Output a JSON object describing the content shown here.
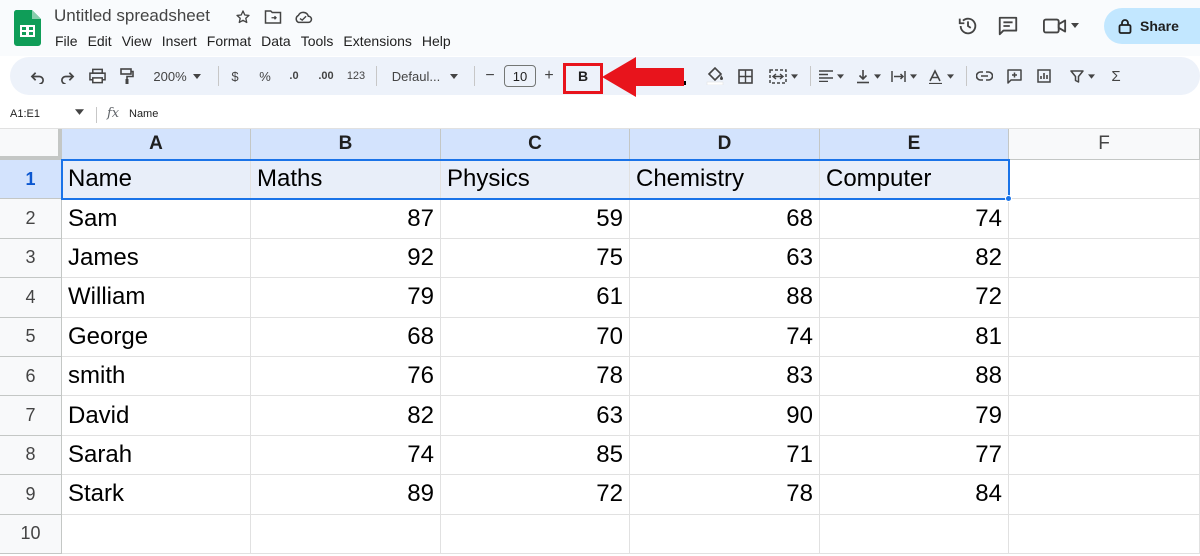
{
  "title": "Untitled spreadsheet",
  "menu": [
    "File",
    "Edit",
    "View",
    "Insert",
    "Format",
    "Data",
    "Tools",
    "Extensions",
    "Help"
  ],
  "share_label": "Share",
  "toolbar": {
    "zoom": "200%",
    "currency": "$",
    "percent": "%",
    "dec_decrease": ".0",
    "dec_increase": ".00",
    "number_format": "123",
    "font": "Defaul...",
    "minus": "−",
    "font_size": "10",
    "plus": "+",
    "bold": "B",
    "sum": "Σ"
  },
  "formula_bar": {
    "name_box": "A1:E1",
    "fx": "fx",
    "value": "Name"
  },
  "sheet": {
    "columns": [
      "A",
      "B",
      "C",
      "D",
      "E",
      "F"
    ],
    "row_numbers": [
      "1",
      "2",
      "3",
      "4",
      "5",
      "6",
      "7",
      "8",
      "9",
      "10"
    ],
    "header": [
      "Name",
      "Maths",
      "Physics",
      "Chemistry",
      "Computer"
    ],
    "rows": [
      [
        "Sam",
        "87",
        "59",
        "68",
        "74"
      ],
      [
        "James",
        "92",
        "75",
        "63",
        "82"
      ],
      [
        "William",
        "79",
        "61",
        "88",
        "72"
      ],
      [
        "George",
        "68",
        "70",
        "74",
        "81"
      ],
      [
        "smith",
        "76",
        "78",
        "83",
        "88"
      ],
      [
        "David",
        "82",
        "63",
        "90",
        "79"
      ],
      [
        "Sarah",
        "74",
        "85",
        "71",
        "77"
      ],
      [
        "Stark",
        "89",
        "72",
        "78",
        "84"
      ]
    ],
    "selected_range": "A1:E1"
  },
  "colors": {
    "accent": "#1a73e8",
    "share_bg": "#c2e7ff",
    "toolbar_bg": "#edf2fa",
    "highlight_red": "#e8141c",
    "sheets_green": "#0f9d58"
  }
}
